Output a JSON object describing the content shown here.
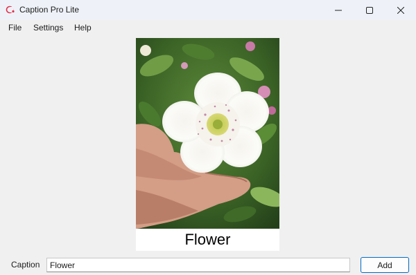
{
  "window": {
    "title": "Caption Pro Lite",
    "icon": "app-logo-icon",
    "controls": [
      "minimize-icon",
      "maximize-icon",
      "close-icon"
    ]
  },
  "menu": {
    "items": [
      {
        "label": "File"
      },
      {
        "label": "Settings"
      },
      {
        "label": "Help"
      }
    ]
  },
  "preview": {
    "image": "photo of white hellebore flower held in hand",
    "caption_text": "Flower"
  },
  "form": {
    "caption_label": "Caption",
    "caption_value": "Flower",
    "add_label": "Add"
  },
  "colors": {
    "titlebar": "#eef2f8",
    "background": "#f0f0f0",
    "accent": "#0067c0"
  }
}
